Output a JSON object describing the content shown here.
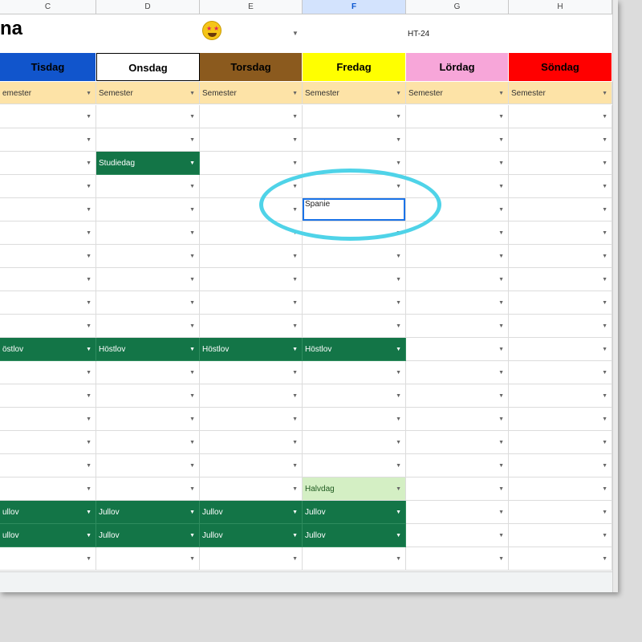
{
  "title": "na",
  "term_label": "HT-24",
  "emoji": "star-struck-emoji",
  "column_letters": [
    "C",
    "D",
    "E",
    "F",
    "G",
    "H"
  ],
  "selected_column": "F",
  "days": [
    {
      "label": "Tisdag",
      "bg": "#1155cc",
      "fg": "#000000"
    },
    {
      "label": "Onsdag",
      "bg": "#ffffff",
      "fg": "#000000"
    },
    {
      "label": "Torsdag",
      "bg": "#8b5a1e",
      "fg": "#000000"
    },
    {
      "label": "Fredag",
      "bg": "#ffff00",
      "fg": "#000000"
    },
    {
      "label": "Lördag",
      "bg": "#f7a6d9",
      "fg": "#000000"
    },
    {
      "label": "Söndag",
      "bg": "#ff0000",
      "fg": "#000000"
    }
  ],
  "rows": [
    [
      "emester",
      "Semester",
      "Semester",
      "Semester",
      "Semester",
      "Semester"
    ],
    [
      "",
      "",
      "",
      "",
      "",
      ""
    ],
    [
      "",
      "",
      "",
      "",
      "",
      ""
    ],
    [
      "",
      "Studiedag",
      "",
      "",
      "",
      ""
    ],
    [
      "",
      "",
      "",
      "",
      "",
      ""
    ],
    [
      "",
      "",
      "",
      "Spanie",
      "",
      ""
    ],
    [
      "",
      "",
      "",
      "",
      "",
      ""
    ],
    [
      "",
      "",
      "",
      "",
      "",
      ""
    ],
    [
      "",
      "",
      "",
      "",
      "",
      ""
    ],
    [
      "",
      "",
      "",
      "",
      "",
      ""
    ],
    [
      "",
      "",
      "",
      "",
      "",
      ""
    ],
    [
      "östlov",
      "Höstlov",
      "Höstlov",
      "Höstlov",
      "",
      ""
    ],
    [
      "",
      "",
      "",
      "",
      "",
      ""
    ],
    [
      "",
      "",
      "",
      "",
      "",
      ""
    ],
    [
      "",
      "",
      "",
      "",
      "",
      ""
    ],
    [
      "",
      "",
      "",
      "",
      "",
      ""
    ],
    [
      "",
      "",
      "",
      "",
      "",
      ""
    ],
    [
      "",
      "",
      "",
      "Halvdag",
      "",
      ""
    ],
    [
      "ullov",
      "Jullov",
      "Jullov",
      "Jullov",
      "",
      ""
    ],
    [
      "ullov",
      "Jullov",
      "Jullov",
      "Jullov",
      "",
      ""
    ],
    [
      "",
      "",
      "",
      "",
      "",
      ""
    ]
  ],
  "styles": {
    "Semester": "sem",
    "emester": "sem",
    "Studiedag": "green",
    "Höstlov": "green",
    "östlov": "green",
    "Jullov": "green",
    "ullov": "green",
    "Halvdag": "light"
  },
  "editing_cell": {
    "row": 5,
    "col": 3
  },
  "highlight_color": "#4fd3e8"
}
